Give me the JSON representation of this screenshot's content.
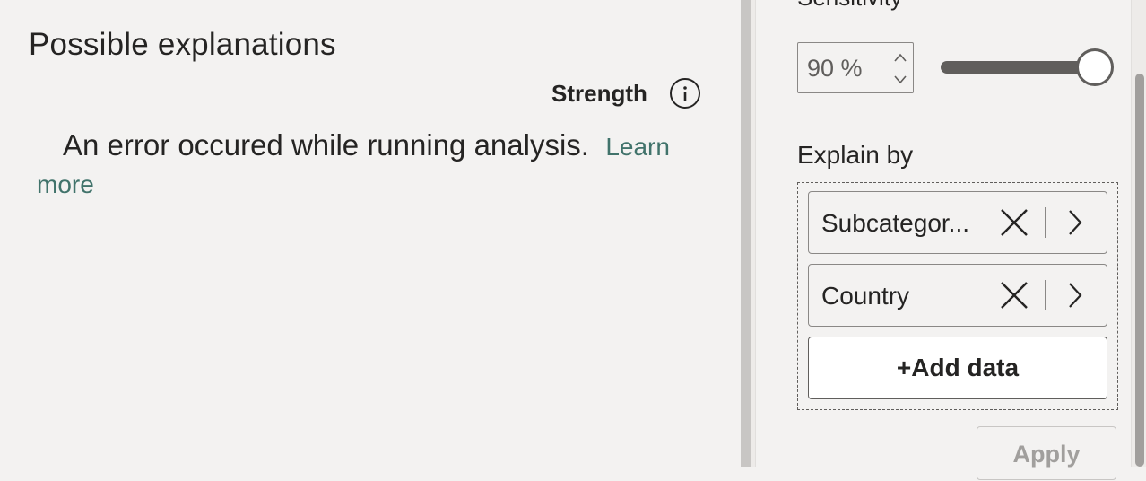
{
  "left": {
    "title": "Possible explanations",
    "strength_label": "Strength",
    "info_icon": "info-icon",
    "error_message": "An error occured while running analysis.",
    "learn_more": "Learn more"
  },
  "right": {
    "sensitivity_label": "Sensitivity",
    "sensitivity_value": "90 %",
    "sensitivity_level_percent": 90,
    "explain_by_label": "Explain by",
    "fields": [
      {
        "label": "Subcategor...",
        "remove_icon": "close-icon",
        "expand_icon": "chevron-right-icon"
      },
      {
        "label": "Country",
        "remove_icon": "close-icon",
        "expand_icon": "chevron-right-icon"
      }
    ],
    "add_data_label": "+Add data",
    "apply_label": "Apply"
  },
  "colors": {
    "background": "#f3f2f1",
    "link": "#41736b",
    "disabled_text": "#a19f9d",
    "slider_track": "#605e5c"
  }
}
